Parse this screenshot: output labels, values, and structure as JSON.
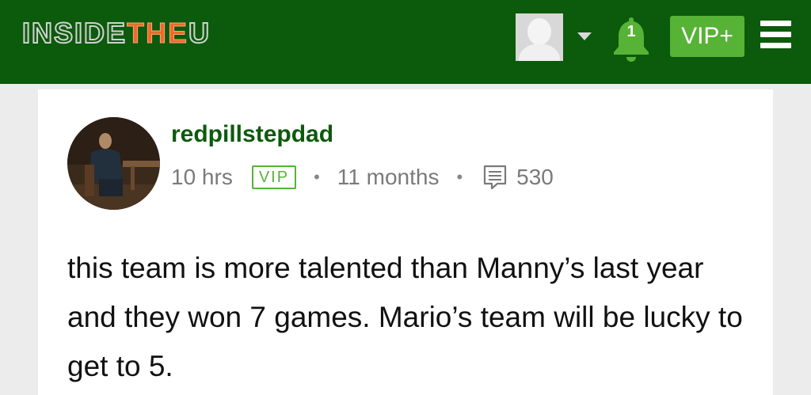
{
  "header": {
    "logo": {
      "part1": "INSIDE",
      "part2": "THE",
      "part3": "U"
    },
    "notification_count": "1",
    "vip_button_label": "VIP+"
  },
  "post": {
    "username": "redpillstepdad",
    "post_age": "10 hrs",
    "badge": "VIP",
    "member_since": "11 months",
    "post_count": "530",
    "body": "this team is more talented than Manny’s last year and they won 7 games. Mario’s team will be lucky to get to 5."
  },
  "colors": {
    "header_bg": "#0c5a0c",
    "accent_green": "#56b335",
    "logo_orange": "#ef6a2b",
    "username": "#0c5a0c"
  }
}
